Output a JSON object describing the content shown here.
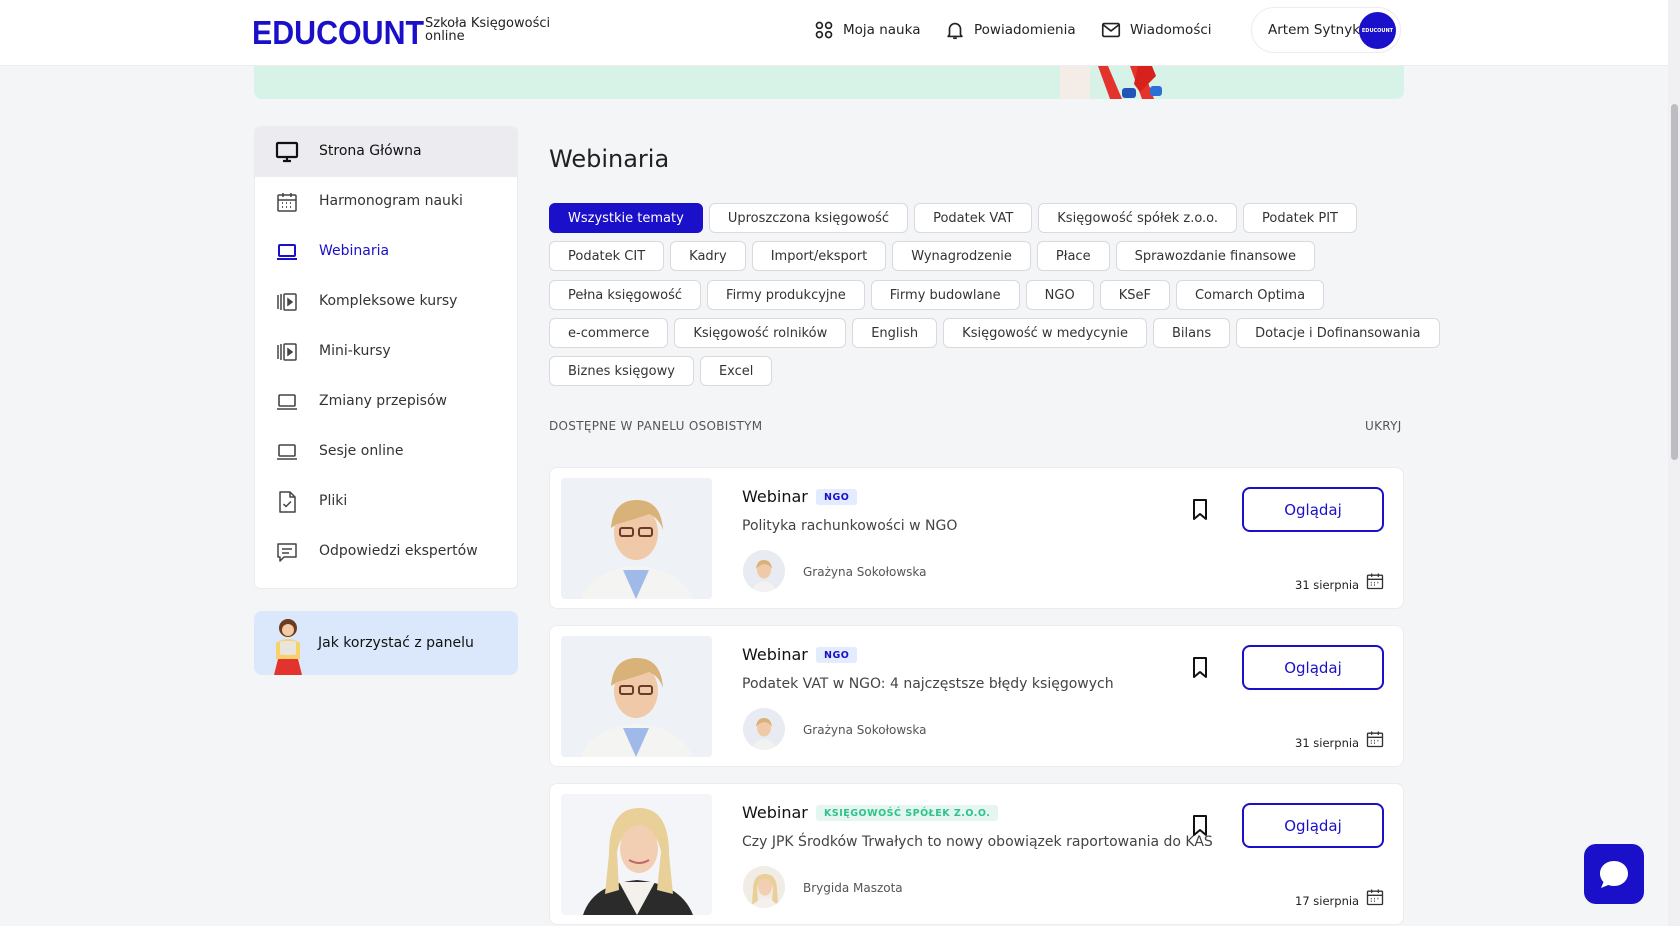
{
  "header": {
    "logo": "EDUCOUNT",
    "logo_sub_line1": "Szkoła Księgowości",
    "logo_sub_line2": "online",
    "nav": {
      "learning": "Moja nauka",
      "notifications": "Powiadomienia",
      "messages": "Wiadomości"
    },
    "user_name": "Artem Sytnyk",
    "avatar_text": "EDUCOUNT"
  },
  "sidebar": {
    "items": [
      {
        "label": "Strona Główna",
        "icon": "monitor-icon"
      },
      {
        "label": "Harmonogram nauki",
        "icon": "calendar-icon"
      },
      {
        "label": "Webinaria",
        "icon": "laptop-icon"
      },
      {
        "label": "Kompleksowe kursy",
        "icon": "video-library-icon"
      },
      {
        "label": "Mini-kursy",
        "icon": "video-library-icon"
      },
      {
        "label": "Zmiany przepisów",
        "icon": "laptop-icon"
      },
      {
        "label": "Sesje online",
        "icon": "laptop-icon"
      },
      {
        "label": "Pliki",
        "icon": "file-check-icon"
      },
      {
        "label": "Odpowiedzi ekspertów",
        "icon": "chat-lines-icon"
      }
    ],
    "help_label": "Jak korzystać z panelu"
  },
  "main": {
    "title": "Webinaria",
    "chips_row1": [
      "Wszystkie tematy",
      "Uproszczona księgowość",
      "Podatek VAT",
      "Księgowość spółek z.o.o.",
      "Podatek PIT"
    ],
    "chips_row2": [
      "Podatek CIT",
      "Kadry",
      "Import/eksport",
      "Wynagrodzenie",
      "Płace",
      "Sprawozdanie finansowe"
    ],
    "chips_row3": [
      "Pełna księgowość",
      "Firmy produkcyjne",
      "Firmy budowlane",
      "NGO",
      "KSeF",
      "Comarch Optima"
    ],
    "chips_row4": [
      "e-commerce",
      "Księgowość rolników",
      "English",
      "Księgowość w medycynie",
      "Bilans",
      "Dotacje i Dofinansowania"
    ],
    "chips_row5": [
      "Biznes księgowy",
      "Excel"
    ],
    "section_label": "DOSTĘPNE W PANELU OSOBISTYM",
    "hide_label": "UKRYJ",
    "cards": [
      {
        "type": "Webinar",
        "tag": "NGO",
        "title": "Polityka rachunkowości w NGO",
        "author": "Grażyna Sokołowska",
        "date": "31 sierpnia",
        "button": "Oglądaj"
      },
      {
        "type": "Webinar",
        "tag": "NGO",
        "title": "Podatek VAT w NGO: 4 najczęstsze błędy księgowych",
        "author": "Grażyna Sokołowska",
        "date": "31 sierpnia",
        "button": "Oglądaj"
      },
      {
        "type": "Webinar",
        "tag": "KSIĘGOWOŚĆ SPÓŁEK Z.O.O.",
        "title": "Czy JPK Środków Trwałych to nowy obowiązek raportowania do KAS",
        "author": "Brygida Maszota",
        "date": "17 sierpnia",
        "button": "Oglądaj"
      }
    ]
  },
  "colors": {
    "brand": "#1a10c9",
    "banner": "#d7f2e7",
    "help_card": "#dbe8fb",
    "tag_ngo_bg": "#e3ebff",
    "tag_spolek_text": "#2ec28c"
  }
}
